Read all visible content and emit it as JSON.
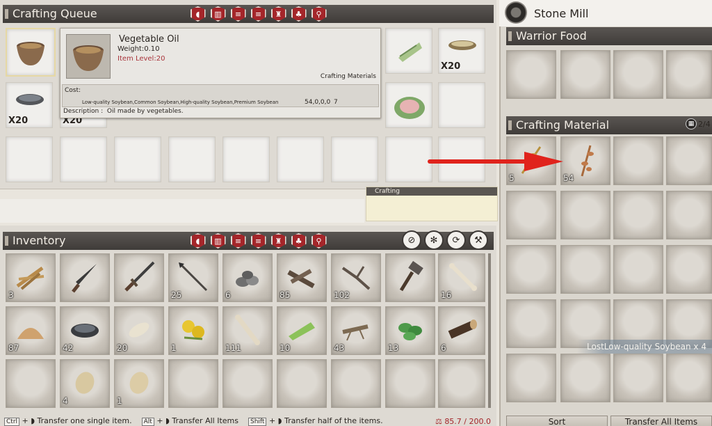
{
  "crafting_queue": {
    "title": "Crafting Queue",
    "queue_qty": [
      "X20",
      "X20"
    ],
    "right_qty": "X20"
  },
  "tooltip": {
    "name": "Vegetable Oil",
    "weight": "Weight:0.10",
    "item_level": "Item Level:20",
    "section_label": "Crafting Materials",
    "cost_label": "Cost:",
    "cost_items": "Low-quality Soybean,Common Soybean,High-quality Soybean,Premium Soybean",
    "cost_values": "54,0,0,0",
    "cost_extra": "7",
    "description": "Description :  Oil made by vegetables."
  },
  "crafting_label": "Crafting",
  "inventory": {
    "title": "Inventory",
    "row1_qty": [
      "3",
      "",
      "",
      "25",
      "6",
      "85",
      "102",
      "",
      "16"
    ],
    "row2_qty": [
      "87",
      "42",
      "20",
      "1",
      "111",
      "10",
      "43",
      "13",
      "6"
    ],
    "row3_qty": [
      "",
      "4",
      "1",
      "",
      "",
      "",
      "",
      "",
      ""
    ]
  },
  "station": {
    "name": "Stone Mill",
    "warrior_food_label": "Warrior Food",
    "crafting_material_label": "Crafting Material",
    "slot_count": "2/4",
    "material_qty": [
      "5",
      "54"
    ],
    "lost_tooltip": "LostLow-quality Soybean x 4"
  },
  "footer": {
    "hint1_key": "Ctrl",
    "hint1": "Transfer one single item.",
    "hint2_key": "Alt",
    "hint2": "Transfer All Items",
    "hint3_key": "Shift",
    "hint3": "Transfer half of the items.",
    "weight": "85.7 / 200.0",
    "sort_label": "Sort",
    "transfer_all_label": "Transfer All Items"
  },
  "colors": {
    "accent": "#a4262a",
    "arrow": "#e0231c",
    "header": "#4a4744"
  }
}
